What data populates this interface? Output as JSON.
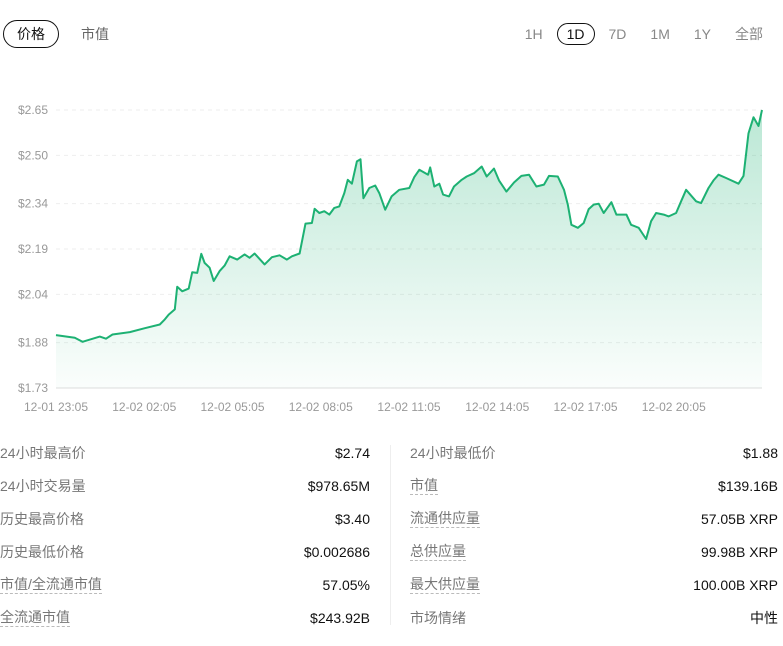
{
  "tabs": [
    {
      "label": "价格",
      "active": true
    },
    {
      "label": "市值",
      "active": false
    }
  ],
  "ranges": [
    {
      "label": "1H"
    },
    {
      "label": "1D",
      "active": true
    },
    {
      "label": "7D"
    },
    {
      "label": "1M"
    },
    {
      "label": "1Y"
    },
    {
      "label": "全部"
    }
  ],
  "colors": {
    "line": "#1db173",
    "fill": "#1db173",
    "grid": "#eeeeee",
    "axis": "#999999"
  },
  "chart_data": {
    "type": "area",
    "title": "",
    "xlabel": "",
    "ylabel": "",
    "ylim": [
      1.73,
      2.65
    ],
    "xlim_hours": [
      0,
      24
    ],
    "y_ticks": [
      "$2.65",
      "$2.50",
      "$2.34",
      "$2.19",
      "$2.04",
      "$1.88",
      "$1.73"
    ],
    "y_tick_values": [
      2.65,
      2.5,
      2.34,
      2.19,
      2.04,
      1.88,
      1.73
    ],
    "x_ticks": [
      "12-01 23:05",
      "12-02 02:05",
      "12-02 05:05",
      "12-02 08:05",
      "12-02 11:05",
      "12-02 14:05",
      "12-02 17:05",
      "12-02 20:05"
    ],
    "x_tick_hours": [
      0,
      3,
      6,
      9,
      12,
      15,
      18,
      21
    ],
    "grid": true,
    "series": [
      {
        "name": "price",
        "t": [
          0,
          0.64,
          0.9,
          1.49,
          1.7,
          1.92,
          2.51,
          3.02,
          3.53,
          3.7,
          3.83,
          4.04,
          4.12,
          4.29,
          4.51,
          4.63,
          4.8,
          4.94,
          5.05,
          5.22,
          5.36,
          5.56,
          5.73,
          5.9,
          6.16,
          6.41,
          6.58,
          6.75,
          7.09,
          7.34,
          7.6,
          7.85,
          8.02,
          8.28,
          8.48,
          8.7,
          8.79,
          8.95,
          9.12,
          9.29,
          9.46,
          9.63,
          9.8,
          9.92,
          10.06,
          10.23,
          10.35,
          10.45,
          10.65,
          10.85,
          10.99,
          11.19,
          11.41,
          11.67,
          12.01,
          12.18,
          12.35,
          12.65,
          12.72,
          12.86,
          13.03,
          13.16,
          13.36,
          13.53,
          13.79,
          13.96,
          14.21,
          14.47,
          14.64,
          14.89,
          15.06,
          15.31,
          15.57,
          15.82,
          16.08,
          16.33,
          16.59,
          16.76,
          17.06,
          17.27,
          17.4,
          17.52,
          17.74,
          17.94,
          18.11,
          18.28,
          18.45,
          18.62,
          18.88,
          19.05,
          19.39,
          19.55,
          19.81,
          20.06,
          20.23,
          20.4,
          20.66,
          20.83,
          21.08,
          21.25,
          21.42,
          21.76,
          21.93,
          22.18,
          22.35,
          22.52,
          22.78,
          23.2,
          23.37,
          23.54,
          23.71,
          23.88,
          24
        ],
        "values": [
          1.905,
          1.896,
          1.883,
          1.9,
          1.893,
          1.907,
          1.915,
          1.928,
          1.94,
          1.957,
          1.973,
          1.99,
          2.065,
          2.05,
          2.059,
          2.113,
          2.111,
          2.174,
          2.144,
          2.128,
          2.084,
          2.117,
          2.135,
          2.166,
          2.155,
          2.172,
          2.161,
          2.175,
          2.139,
          2.163,
          2.169,
          2.155,
          2.166,
          2.175,
          2.274,
          2.276,
          2.323,
          2.309,
          2.315,
          2.304,
          2.326,
          2.331,
          2.375,
          2.419,
          2.406,
          2.48,
          2.487,
          2.358,
          2.392,
          2.4,
          2.375,
          2.32,
          2.364,
          2.386,
          2.392,
          2.428,
          2.452,
          2.436,
          2.46,
          2.397,
          2.406,
          2.37,
          2.364,
          2.397,
          2.419,
          2.43,
          2.441,
          2.463,
          2.43,
          2.456,
          2.417,
          2.38,
          2.41,
          2.432,
          2.436,
          2.397,
          2.403,
          2.432,
          2.43,
          2.386,
          2.337,
          2.27,
          2.26,
          2.276,
          2.322,
          2.337,
          2.34,
          2.309,
          2.345,
          2.304,
          2.304,
          2.27,
          2.26,
          2.223,
          2.282,
          2.309,
          2.304,
          2.298,
          2.309,
          2.348,
          2.386,
          2.348,
          2.342,
          2.392,
          2.417,
          2.436,
          2.425,
          2.406,
          2.432,
          2.573,
          2.626,
          2.597,
          2.65
        ]
      }
    ]
  },
  "stats": {
    "left": [
      {
        "label": "24小时最高价",
        "value": "$2.74",
        "dashed": false
      },
      {
        "label": "24小时交易量",
        "value": "$978.65M",
        "dashed": false
      },
      {
        "label": "历史最高价格",
        "value": "$3.40",
        "dashed": false
      },
      {
        "label": "历史最低价格",
        "value": "$0.002686",
        "dashed": false
      },
      {
        "label": "市值/全流通市值",
        "value": "57.05%",
        "dashed": true
      },
      {
        "label": "全流通市值",
        "value": "$243.92B",
        "dashed": true
      }
    ],
    "right": [
      {
        "label": "24小时最低价",
        "value": "$1.88",
        "dashed": false
      },
      {
        "label": "市值",
        "value": "$139.16B",
        "dashed": true
      },
      {
        "label": "流通供应量",
        "value": "57.05B XRP",
        "dashed": true
      },
      {
        "label": "总供应量",
        "value": "99.98B XRP",
        "dashed": true
      },
      {
        "label": "最大供应量",
        "value": "100.00B XRP",
        "dashed": true
      },
      {
        "label": "市场情绪",
        "value": "中性",
        "dashed": false
      }
    ]
  }
}
